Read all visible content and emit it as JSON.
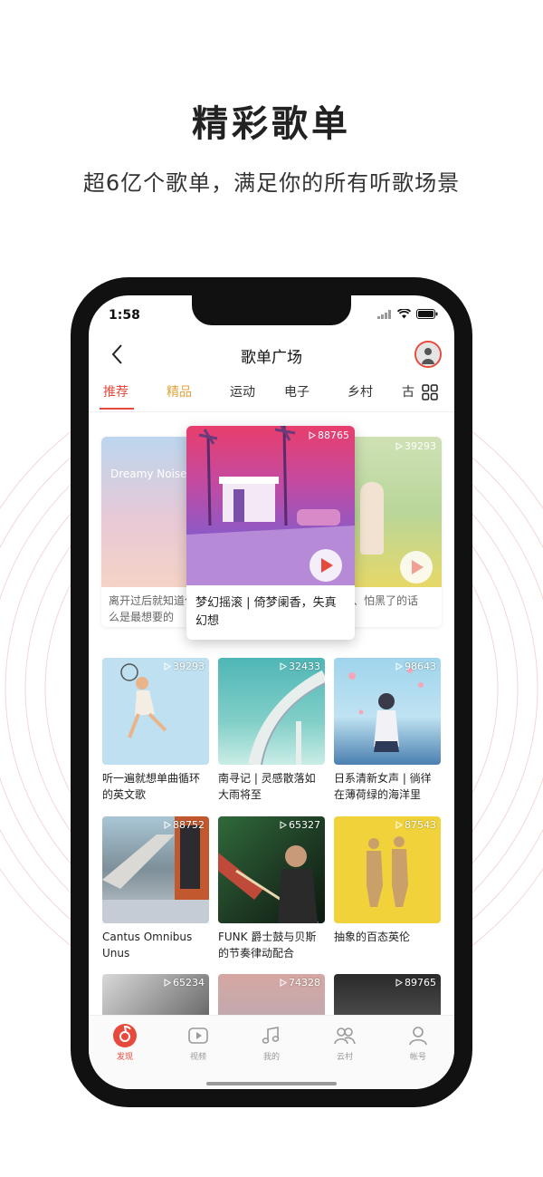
{
  "promo": {
    "title": "精彩歌单",
    "subtitle": "超6亿个歌单，满足你的所有听歌场景"
  },
  "status_bar": {
    "time": "1:58"
  },
  "nav": {
    "title": "歌单广场"
  },
  "tabs": [
    {
      "label": "推荐"
    },
    {
      "label": "精品"
    },
    {
      "label": "运动"
    },
    {
      "label": "电子"
    },
    {
      "label": "乡村"
    },
    {
      "label": "古"
    }
  ],
  "carousel": {
    "left": {
      "count": "",
      "cover_text": "Dreamy Noise",
      "title": "离开过后就知道什么是最想要的"
    },
    "center": {
      "count": "88765",
      "title": "梦幻摇滚 | 倚梦阑香，失真幻想"
    },
    "right": {
      "count": "39293",
      "title": "系、怕黑了的话"
    }
  },
  "playlists": [
    {
      "count": "39293",
      "title": "听一遍就想单曲循环的英文歌"
    },
    {
      "count": "32433",
      "title": "南寻记 | 灵感散落如大雨将至"
    },
    {
      "count": "98643",
      "title": "日系清新女声 | 徜徉在薄荷绿的海洋里"
    },
    {
      "count": "88752",
      "title": "Cantus Omnibus Unus"
    },
    {
      "count": "65327",
      "title": "FUNK 爵士鼓与贝斯的节奏律动配合"
    },
    {
      "count": "87543",
      "title": "抽象的百态英伦"
    },
    {
      "count": "65234",
      "title": ""
    },
    {
      "count": "74328",
      "title": ""
    },
    {
      "count": "89765",
      "title": ""
    }
  ],
  "bottom_nav": [
    {
      "label": "发现",
      "icon": "netease-music-icon"
    },
    {
      "label": "视频",
      "icon": "video-icon"
    },
    {
      "label": "我的",
      "icon": "music-note-icon"
    },
    {
      "label": "云村",
      "icon": "friends-icon"
    },
    {
      "label": "帐号",
      "icon": "account-icon"
    }
  ],
  "colors": {
    "accent": "#e64a3c",
    "gold": "#e0a23e"
  }
}
